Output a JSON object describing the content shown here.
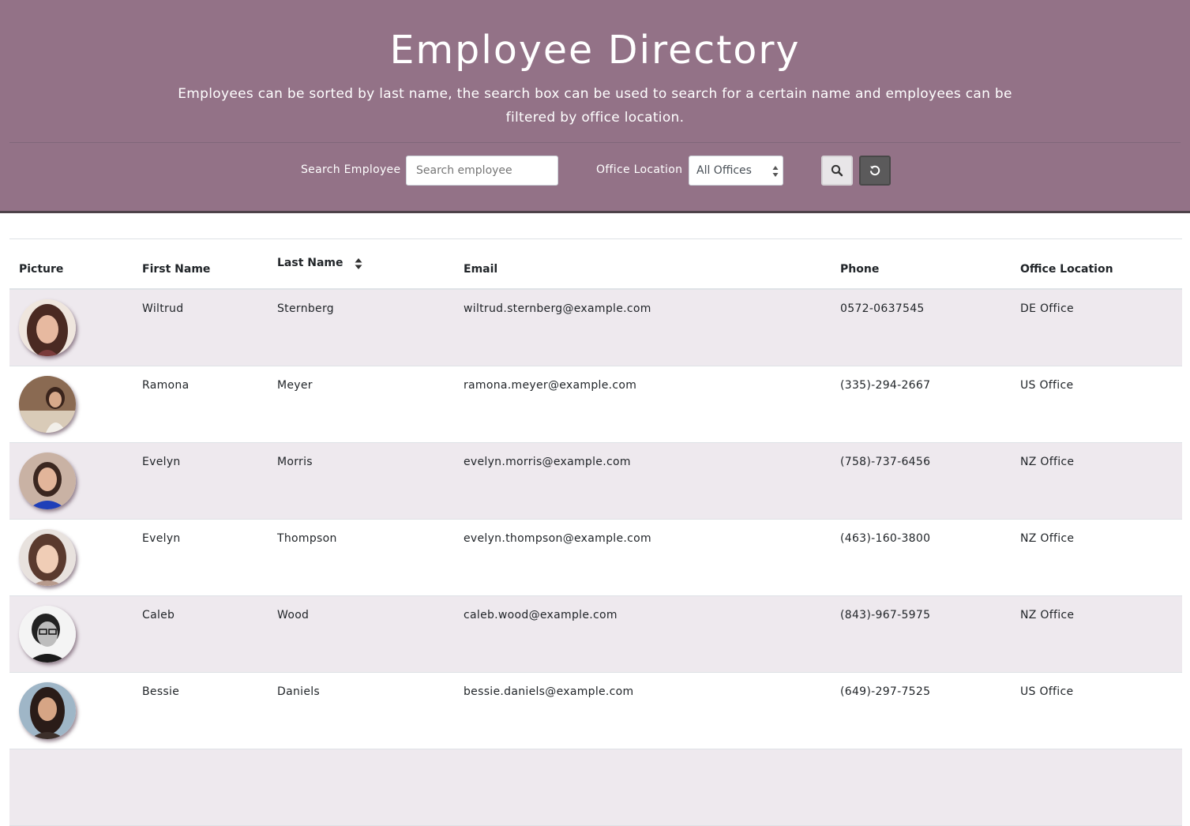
{
  "header": {
    "title": "Employee Directory",
    "subtitle": "Employees can be sorted by last name, the search box can be used to search for a certain name and employees can be filtered by office location."
  },
  "controls": {
    "search_label": "Search Employee",
    "search_placeholder": "Search employee",
    "search_value": "",
    "location_label": "Office Location",
    "location_selected": "All Offices",
    "search_button_icon": "search-icon",
    "reset_button_icon": "reset-icon"
  },
  "table": {
    "columns": {
      "picture": "Picture",
      "first_name": "First Name",
      "last_name": "Last Name",
      "email": "Email",
      "phone": "Phone",
      "office_location": "Office Location"
    },
    "sort_icon": "sort-icon",
    "rows": [
      {
        "first": "Wiltrud",
        "last": "Sternberg",
        "email": "wiltrud.sternberg@example.com",
        "phone": "0572-0637545",
        "office": "DE Office"
      },
      {
        "first": "Ramona",
        "last": "Meyer",
        "email": "ramona.meyer@example.com",
        "phone": "(335)-294-2667",
        "office": "US Office"
      },
      {
        "first": "Evelyn",
        "last": "Morris",
        "email": "evelyn.morris@example.com",
        "phone": "(758)-737-6456",
        "office": "NZ Office"
      },
      {
        "first": "Evelyn",
        "last": "Thompson",
        "email": "evelyn.thompson@example.com",
        "phone": "(463)-160-3800",
        "office": "NZ Office"
      },
      {
        "first": "Caleb",
        "last": "Wood",
        "email": "caleb.wood@example.com",
        "phone": "(843)-967-5975",
        "office": "NZ Office"
      },
      {
        "first": "Bessie",
        "last": "Daniels",
        "email": "bessie.daniels@example.com",
        "phone": "(649)-297-7525",
        "office": "US Office"
      }
    ]
  },
  "colors": {
    "header_bg": "#937287",
    "header_border": "#4e4249",
    "row_stripe": "#eee9ee",
    "reset_button": "#5b5a5b"
  }
}
